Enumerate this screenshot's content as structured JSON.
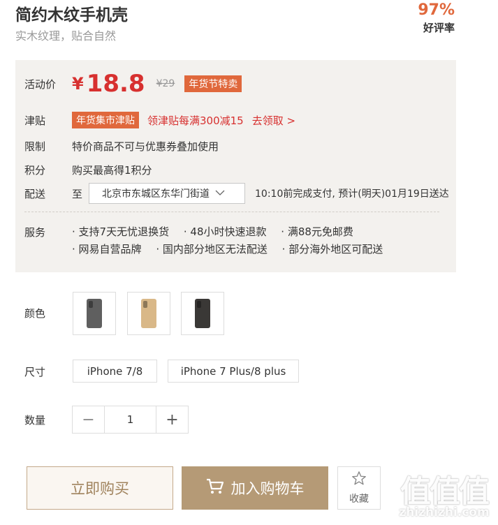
{
  "product": {
    "title": "简约木纹手机壳",
    "subtitle": "实木纹理，贴合自然"
  },
  "rating": {
    "value": "97%",
    "label": "好评率"
  },
  "price": {
    "label": "活动价",
    "currency": "¥",
    "current": "18.8",
    "original": "¥29",
    "promo_tag": "年货节特卖"
  },
  "subsidy": {
    "label": "津贴",
    "tag": "年货集市津贴",
    "text": "领津贴每满300减15",
    "link": "去领取 >"
  },
  "restriction": {
    "label": "限制",
    "text": "特价商品不可与优惠券叠加使用"
  },
  "points": {
    "label": "积分",
    "text": "购买最高得1积分"
  },
  "delivery": {
    "label": "配送",
    "to": "至",
    "address": "北京市东城区东华门街道",
    "note": "10:10前完成支付, 预计(明天)01月19日送达"
  },
  "services": {
    "label": "服务",
    "line1": [
      "· 支持7天无忧退换货",
      "· 48小时快速退款",
      "· 满88元免邮费"
    ],
    "line2": [
      "· 网易自营品牌",
      "· 国内部分地区无法配送",
      "· 部分海外地区可配送"
    ]
  },
  "color": {
    "label": "颜色",
    "swatches": [
      "#5f5f5f",
      "#d9b888",
      "#3a3836"
    ]
  },
  "size": {
    "label": "尺寸",
    "options": [
      "iPhone 7/8",
      "iPhone 7 Plus/8 plus"
    ]
  },
  "quantity": {
    "label": "数量",
    "minus": "−",
    "value": "1",
    "plus": "+"
  },
  "actions": {
    "buy_now": "立即购买",
    "add_to_cart": "加入购物车",
    "favorite": "收藏"
  },
  "watermark": {
    "logo": "值值值",
    "url": "zhizhizhi.com"
  },
  "colors": {
    "accent": "#e0683c",
    "price": "#d7302f",
    "gold": "#b59a76"
  }
}
